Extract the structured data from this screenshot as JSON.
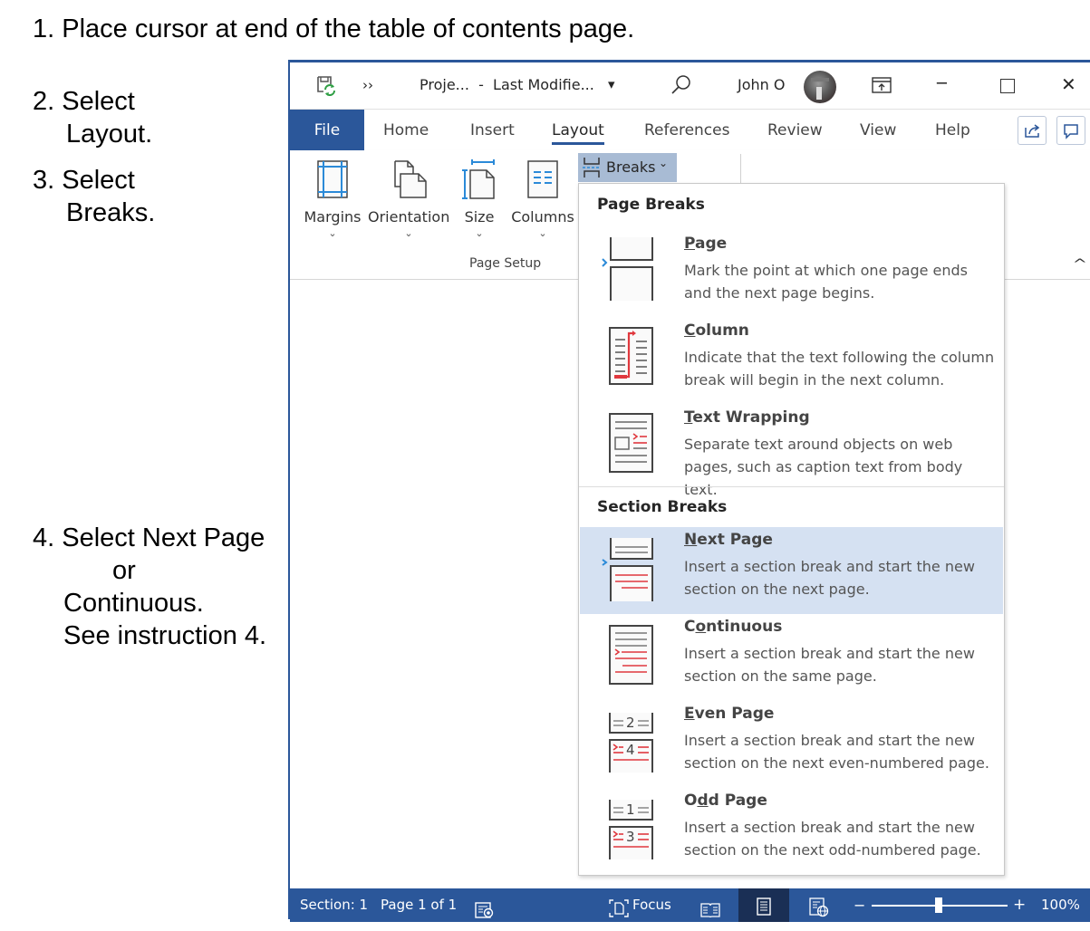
{
  "instructions": {
    "step1": "1. Place cursor at end of the table of contents page.",
    "step2a": "2. Select",
    "step2b": "Layout.",
    "step3a": "3. Select",
    "step3b": "Breaks.",
    "step4a": "4. Select Next Page",
    "step4b": "or",
    "step4c": "Continuous.",
    "step4d": "See instruction 4."
  },
  "titlebar": {
    "overflow_glyph": "››",
    "doc_title": "Proje...  -  Last Modifie...",
    "dropdown_glyph": "▾",
    "search_icon": "search-icon",
    "user_name": "John O",
    "minimize_glyph": "─",
    "maximize_glyph": "☐",
    "close_glyph": "✕"
  },
  "tabs": [
    {
      "label": "File"
    },
    {
      "label": "Home"
    },
    {
      "label": "Insert"
    },
    {
      "label": "Layout",
      "active": true
    },
    {
      "label": "References"
    },
    {
      "label": "Review"
    },
    {
      "label": "View"
    },
    {
      "label": "Help"
    }
  ],
  "ribbon": {
    "buttons": [
      {
        "label": "Margins"
      },
      {
        "label": "Orientation"
      },
      {
        "label": "Size"
      },
      {
        "label": "Columns"
      }
    ],
    "chevron": "⌄",
    "group_label": "Page Setup",
    "breaks_label": "Breaks",
    "breaks_chevron": "⌄",
    "collapse_glyph": "^"
  },
  "breaks_menu": {
    "page_breaks_heading": "Page Breaks",
    "section_breaks_heading": "Section Breaks",
    "items": [
      {
        "key": "P",
        "rest": "age",
        "title": "Page",
        "desc": "Mark the point at which one page ends and the next page begins."
      },
      {
        "key": "C",
        "rest": "olumn",
        "title": "Column",
        "desc": "Indicate that the text following the column break will begin in the next column."
      },
      {
        "key": "T",
        "rest": "ext Wrapping",
        "title": "Text Wrapping",
        "desc": "Separate text around objects on web pages, such as caption text from body text."
      },
      {
        "key": "N",
        "rest": "ext Page",
        "title": "Next Page",
        "desc": "Insert a section break and start the new section on the next page.",
        "highlighted": true
      },
      {
        "pre": "C",
        "key": "o",
        "rest": "ntinuous",
        "title": "Continuous",
        "desc": "Insert a section break and start the new section on the same page."
      },
      {
        "key": "E",
        "rest": "ven Page",
        "title": "Even Page",
        "desc": "Insert a section break and start the new section on the next even-numbered page.",
        "num_top": "2",
        "num_bottom": "4"
      },
      {
        "pre": "O",
        "key": "d",
        "rest": "d Page",
        "title": "Odd Page",
        "desc": "Insert a section break and start the new section on the next odd-numbered page.",
        "num_top": "1",
        "num_bottom": "3"
      }
    ]
  },
  "statusbar": {
    "section": "Section: 1",
    "page": "Page 1 of 1",
    "focus": "Focus",
    "zoom_minus": "−",
    "zoom_plus": "+",
    "zoom_level": "100%",
    "zoom_percent": 100
  },
  "colors": {
    "accent": "#2b579a",
    "highlight": "#d5e1f2",
    "breaks_button": "#a8bbd4",
    "icon_red": "#e0383e",
    "icon_blue": "#2b8ad8"
  }
}
